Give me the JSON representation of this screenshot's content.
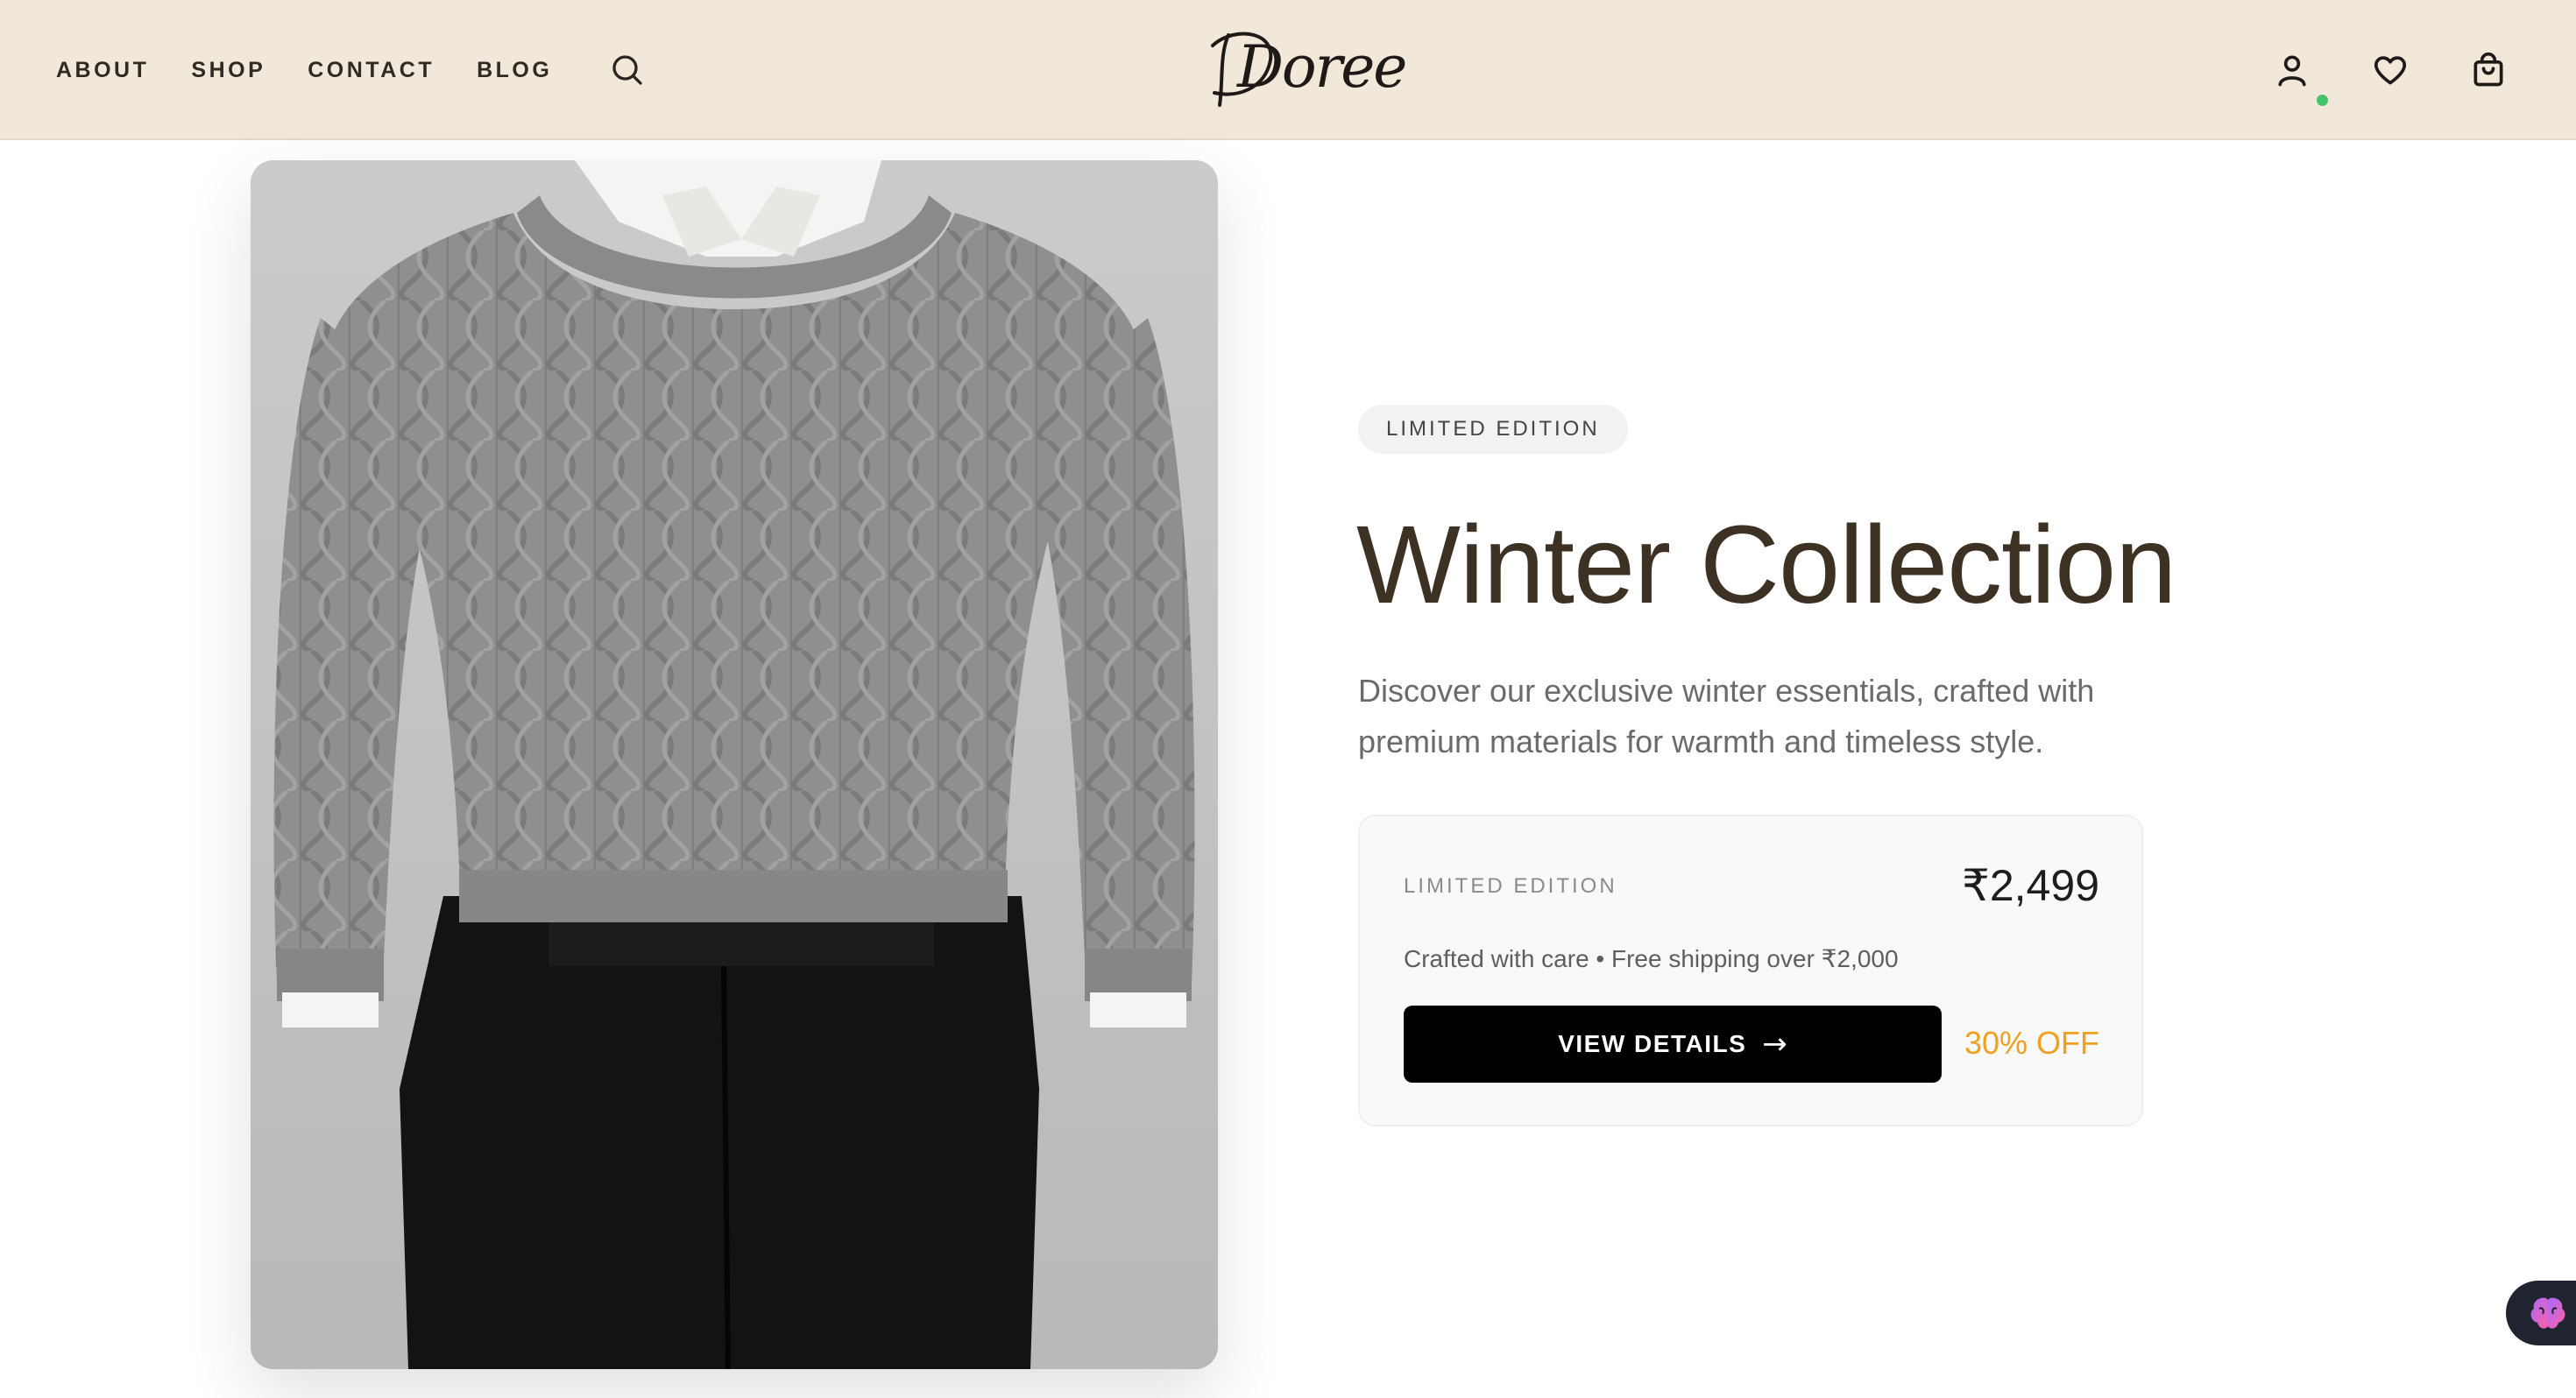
{
  "header": {
    "nav": [
      "ABOUT",
      "SHOP",
      "CONTACT",
      "BLOG"
    ],
    "logo_text": "Doree",
    "icons": [
      "search-icon",
      "user-icon",
      "heart-icon",
      "cart-icon"
    ],
    "status_color": "#45c36a",
    "background": "#f2e8da"
  },
  "hero": {
    "badge": "LIMITED EDITION",
    "title": "Winter Collection",
    "description": "Discover our exclusive winter essentials, crafted with premium materials for warmth and timeless style.",
    "card": {
      "label": "LIMITED EDITION",
      "price": "₹2,499",
      "subtitle": "Crafted with care • Free shipping over ₹2,000",
      "cta_label": "VIEW DETAILS",
      "cta_arrow": "→",
      "discount": "30% OFF"
    }
  },
  "colors": {
    "title": "#3d3124",
    "discount": "#f0a020",
    "cta": "#000000"
  }
}
